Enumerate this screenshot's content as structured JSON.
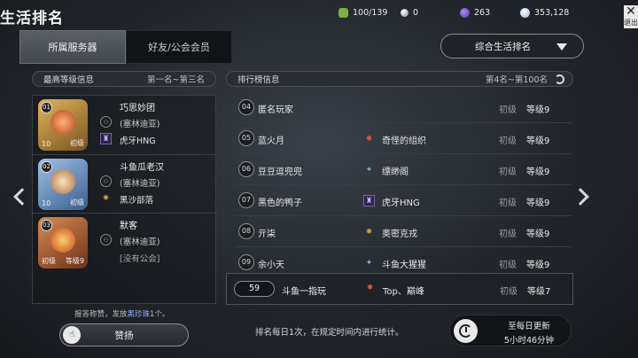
{
  "header": {
    "title": "生活排名",
    "resources": [
      {
        "icon": "energy-icon",
        "value": "100/139",
        "color": "#7fae46"
      },
      {
        "icon": "silver-pearl-icon",
        "value": "0",
        "color": "#c8c8c8"
      },
      {
        "icon": "purple-crystal-icon",
        "value": "263",
        "color": "#7b4fd6"
      },
      {
        "icon": "diamond-icon",
        "value": "353,128",
        "color": "#b9d7ff"
      }
    ],
    "exit_label": "退出"
  },
  "tabs": [
    {
      "label": "所属服务器",
      "active": true
    },
    {
      "label": "好友/公会会员",
      "active": false
    }
  ],
  "dropdown": {
    "selected": "综合生活排名"
  },
  "top_section": {
    "title": "最高等级信息",
    "range": "第一名~第三名"
  },
  "top_ranks": [
    {
      "rank": "01",
      "tier_level": "10",
      "tier": "初级",
      "name": "巧思妙团",
      "server": "(塞林迪亚)",
      "guild": "虎牙HNG",
      "medal_color": "#c9953a"
    },
    {
      "rank": "02",
      "tier_level": "10",
      "tier": "初级",
      "name": "斗鱼瓜老汉",
      "server": "(塞林迪亚)",
      "guild": "黑沙部落",
      "medal_color": "#6f93c2"
    },
    {
      "rank": "03",
      "tier_level": "初级",
      "tier": "等级9",
      "name": "默客",
      "server": "(塞林迪亚)",
      "guild": "[没有公会]",
      "medal_color": "#b5683a"
    }
  ],
  "list_section": {
    "title": "排行榜信息",
    "range": "第4名~第100名"
  },
  "rank_list": [
    {
      "rank": "04",
      "name": "匿名玩家",
      "guild": "",
      "guild_icon": "",
      "tier": "初级",
      "level": "等级9"
    },
    {
      "rank": "05",
      "name": "蓝火月",
      "guild": "奇怪的组织",
      "guild_icon": "star",
      "tier": "初级",
      "level": "等级9"
    },
    {
      "rank": "06",
      "name": "豆豆逗兜兜",
      "guild": "缥缈阁",
      "guild_icon": "star-blue",
      "tier": "初级",
      "level": "等级9"
    },
    {
      "rank": "07",
      "name": "黑色的鸭子",
      "guild": "虎牙HNG",
      "guild_icon": "guild",
      "tier": "初级",
      "level": "等级9"
    },
    {
      "rank": "08",
      "name": "亓柒",
      "guild": "奥密克戎",
      "guild_icon": "star",
      "tier": "初级",
      "level": "等级9"
    },
    {
      "rank": "09",
      "name": "余小天",
      "guild": "斗鱼大猩猩",
      "guild_icon": "star-blue",
      "tier": "初级",
      "level": "等级9"
    }
  ],
  "my_rank": {
    "rank": "59",
    "name": "斗鱼一指玩",
    "guild": "Top、巅峰",
    "tier": "初级",
    "level": "等级7"
  },
  "footer": {
    "praise_note_pre": "报答称赞，发放",
    "praise_note_hl": "黑珍珠",
    "praise_note_post": "1个。",
    "praise_button": "赞扬",
    "stat_note": "排名每日1次，在规定时间内进行统计。",
    "update_line1": "至每日更新",
    "update_line2": "5小时46分钟"
  }
}
